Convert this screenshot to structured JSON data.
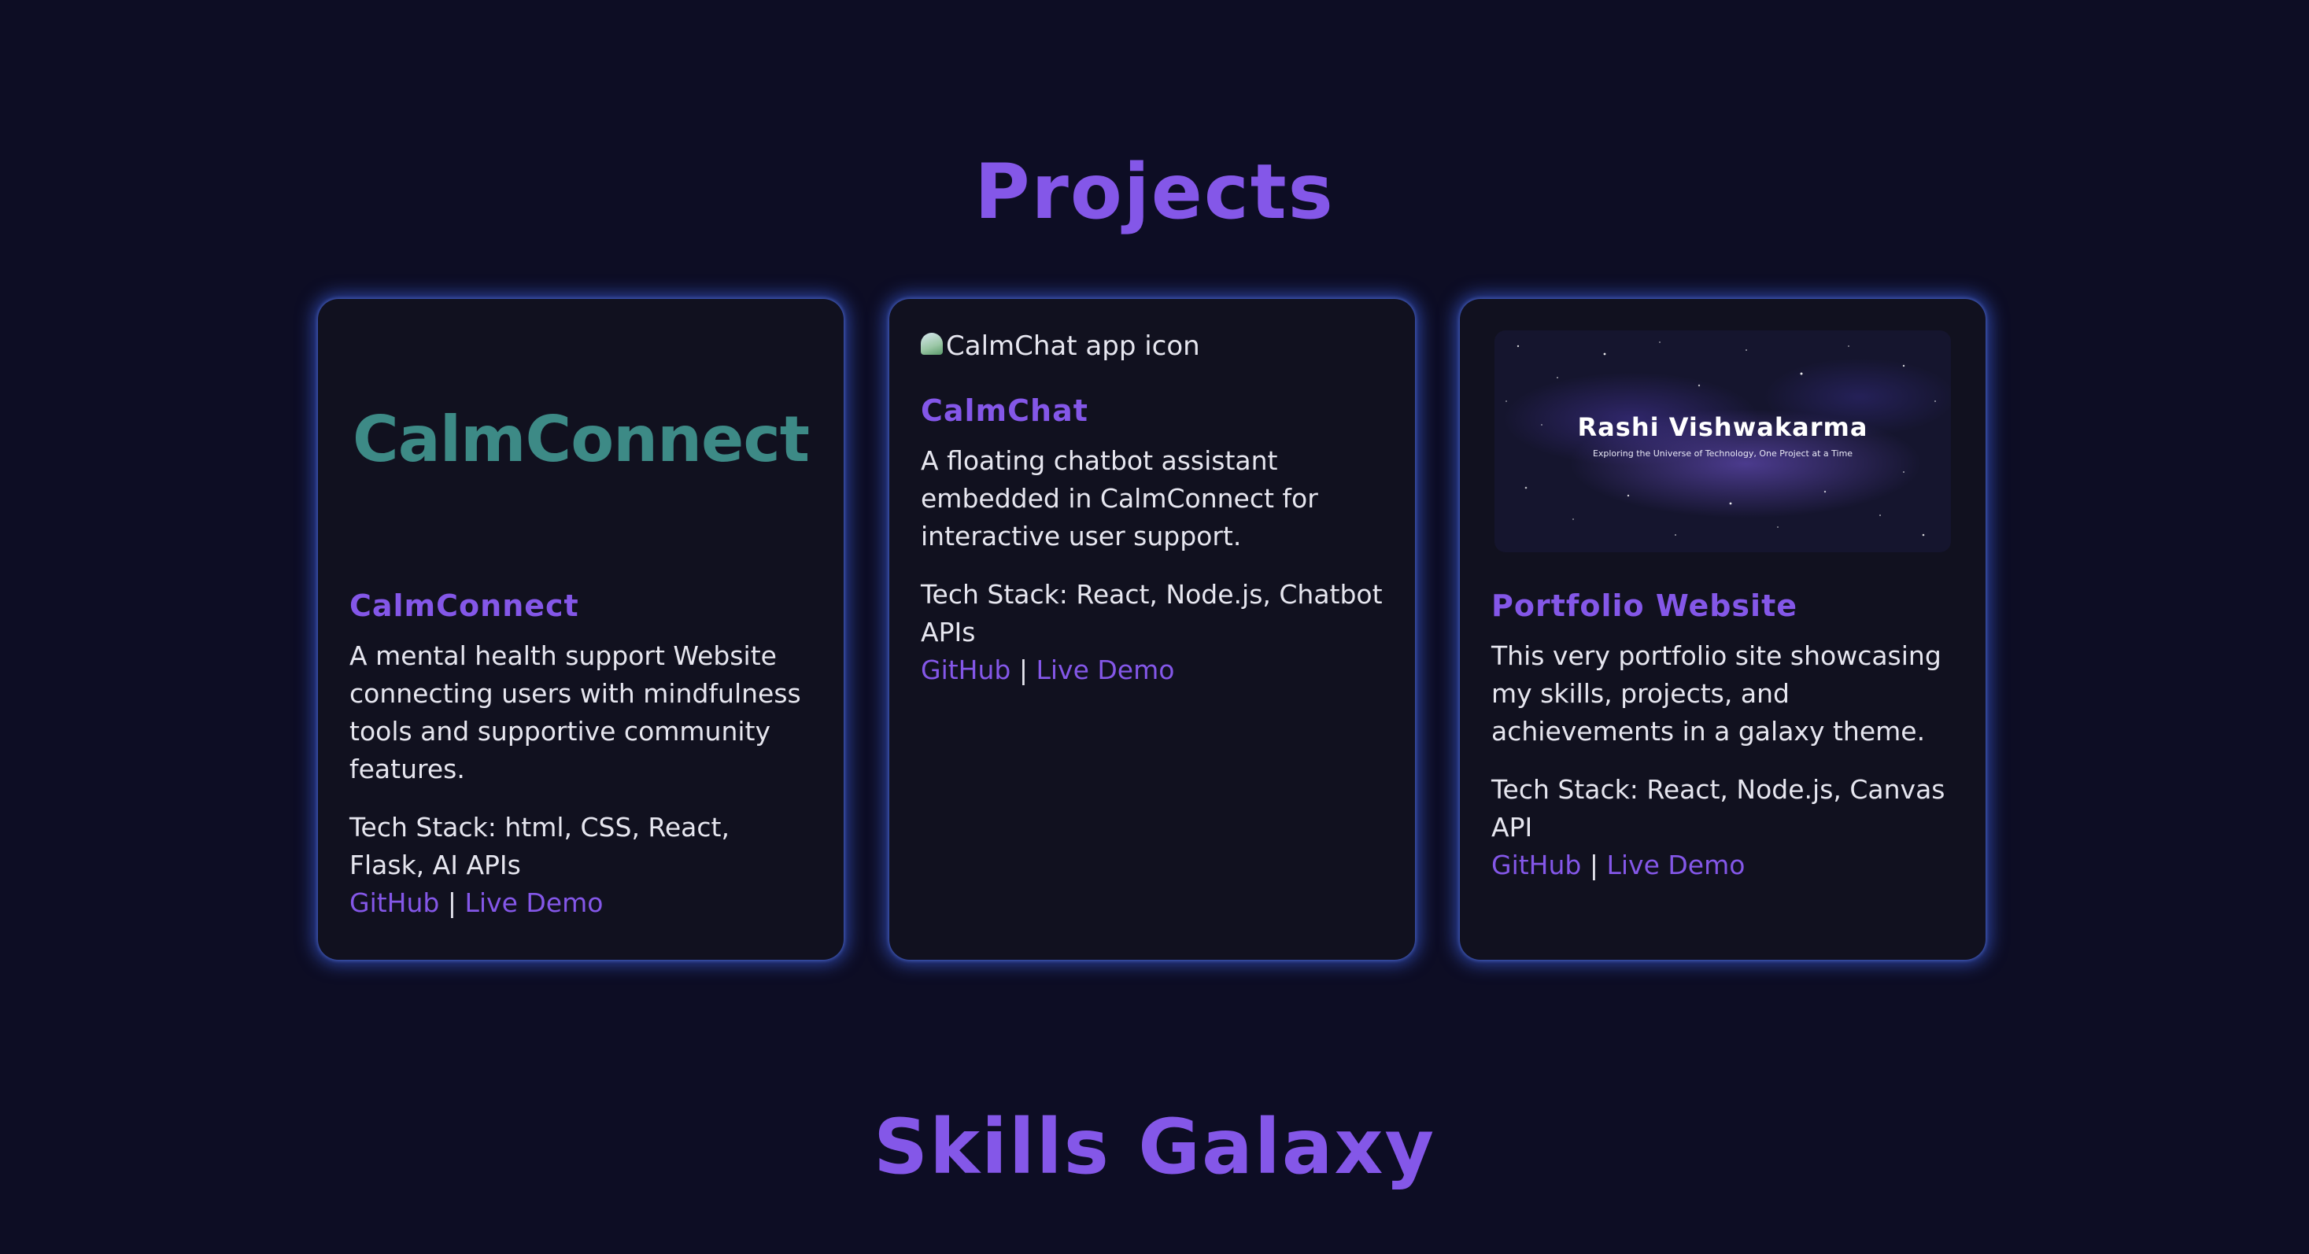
{
  "projects_section": {
    "title": "Projects"
  },
  "projects": [
    {
      "logo_text": "CalmConnect",
      "title": "CalmConnect",
      "description": "A mental health support Website connecting users with mindfulness tools and supportive community features.",
      "tech_stack": "Tech Stack: html, CSS, React, Flask, AI APIs",
      "github_label": "GitHub",
      "separator": "|",
      "demo_label": "Live Demo"
    },
    {
      "image_alt": "CalmChat app icon",
      "title": "CalmChat",
      "description": "A floating chatbot assistant embedded in CalmConnect for interactive user support.",
      "tech_stack": "Tech Stack: React, Node.js, Chatbot APIs",
      "github_label": "GitHub",
      "separator": "|",
      "demo_label": "Live Demo"
    },
    {
      "banner_name": "Rashi Vishwakarma",
      "banner_tagline": "Exploring the Universe of Technology, One Project at a Time",
      "title": "Portfolio Website",
      "description": "This very portfolio site showcasing my skills, projects, and achievements in a galaxy theme.",
      "tech_stack": "Tech Stack: React, Node.js, Canvas API",
      "github_label": "GitHub",
      "separator": "|",
      "demo_label": "Live Demo"
    }
  ],
  "skills_section": {
    "title": "Skills Galaxy"
  },
  "colors": {
    "background": "#0d0d24",
    "card_background": "#11111f",
    "accent": "#8457e8",
    "glow": "#466eff",
    "logo_teal": "#3d8a86",
    "text": "#e6e6ef"
  }
}
